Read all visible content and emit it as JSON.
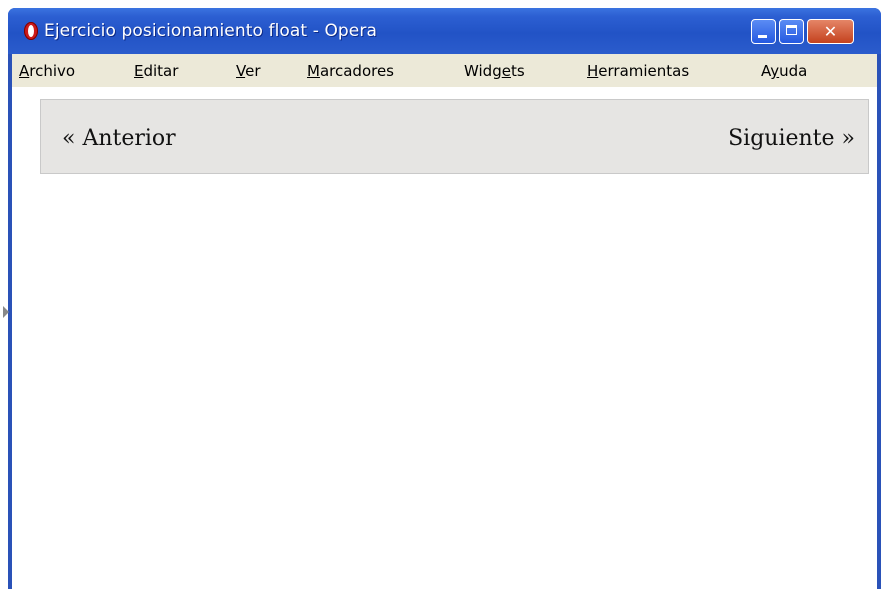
{
  "window": {
    "title": "Ejercicio posicionamiento float - Opera",
    "app_icon": "opera-logo-icon",
    "controls": {
      "minimize_icon": "minimize-icon",
      "maximize_icon": "maximize-icon",
      "close_icon": "close-icon",
      "close_glyph": "✕"
    }
  },
  "menubar": {
    "items": [
      {
        "underline": "A",
        "rest": "rchivo"
      },
      {
        "underline": "E",
        "rest": "ditar"
      },
      {
        "underline": "V",
        "rest": "er"
      },
      {
        "underline": "M",
        "rest": "arcadores"
      },
      {
        "prefix": "Widg",
        "underline": "e",
        "rest": "ts"
      },
      {
        "underline": "H",
        "rest": "erramientas"
      },
      {
        "prefix": "A",
        "underline": "y",
        "rest": "uda"
      }
    ]
  },
  "page": {
    "prev_label": "« Anterior",
    "next_label": "Siguiente »"
  },
  "colors": {
    "titlebar": "#2253c6",
    "menubar": "#ece9d8",
    "navbox": "#e6e5e3"
  }
}
